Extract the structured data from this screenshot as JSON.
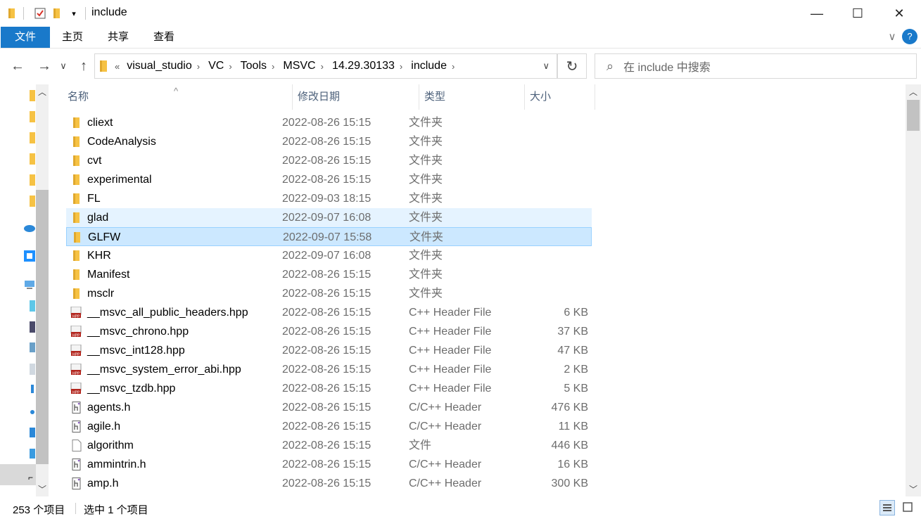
{
  "window": {
    "title": "include",
    "minimize_glyph": "—",
    "maximize_glyph": "☐",
    "close_glyph": "✕"
  },
  "ribbon": {
    "tabs": [
      "文件",
      "主页",
      "共享",
      "查看"
    ],
    "expand_glyph": "∨",
    "help_glyph": "?"
  },
  "address": {
    "overflow_glyph": "«",
    "crumbs": [
      "visual_studio",
      "VC",
      "Tools",
      "MSVC",
      "14.29.30133",
      "include"
    ],
    "sep_glyph": "›",
    "dropdown_glyph": "∨",
    "refresh_glyph": "↻"
  },
  "nav": {
    "back_glyph": "←",
    "forward_glyph": "→",
    "recent_glyph": "∨",
    "up_glyph": "↑"
  },
  "search": {
    "placeholder": "在 include 中搜索",
    "icon_glyph": "⌕"
  },
  "columns": {
    "name": "名称",
    "date": "修改日期",
    "type": "类型",
    "size": "大小",
    "sort_glyph": "^"
  },
  "files": [
    {
      "name": "cliext",
      "date": "2022-08-26 15:15",
      "type": "文件夹",
      "size": "",
      "icon": "folder-icon"
    },
    {
      "name": "CodeAnalysis",
      "date": "2022-08-26 15:15",
      "type": "文件夹",
      "size": "",
      "icon": "folder-icon"
    },
    {
      "name": "cvt",
      "date": "2022-08-26 15:15",
      "type": "文件夹",
      "size": "",
      "icon": "folder-icon"
    },
    {
      "name": "experimental",
      "date": "2022-08-26 15:15",
      "type": "文件夹",
      "size": "",
      "icon": "folder-icon"
    },
    {
      "name": "FL",
      "date": "2022-09-03 18:15",
      "type": "文件夹",
      "size": "",
      "icon": "folder-icon"
    },
    {
      "name": "glad",
      "date": "2022-09-07 16:08",
      "type": "文件夹",
      "size": "",
      "icon": "folder-icon"
    },
    {
      "name": "GLFW",
      "date": "2022-09-07 15:58",
      "type": "文件夹",
      "size": "",
      "icon": "folder-icon"
    },
    {
      "name": "KHR",
      "date": "2022-09-07 16:08",
      "type": "文件夹",
      "size": "",
      "icon": "folder-icon"
    },
    {
      "name": "Manifest",
      "date": "2022-08-26 15:15",
      "type": "文件夹",
      "size": "",
      "icon": "folder-icon"
    },
    {
      "name": "msclr",
      "date": "2022-08-26 15:15",
      "type": "文件夹",
      "size": "",
      "icon": "folder-icon"
    },
    {
      "name": "__msvc_all_public_headers.hpp",
      "date": "2022-08-26 15:15",
      "type": "C++ Header File",
      "size": "6 KB",
      "icon": "hpp-file-icon"
    },
    {
      "name": "__msvc_chrono.hpp",
      "date": "2022-08-26 15:15",
      "type": "C++ Header File",
      "size": "37 KB",
      "icon": "hpp-file-icon"
    },
    {
      "name": "__msvc_int128.hpp",
      "date": "2022-08-26 15:15",
      "type": "C++ Header File",
      "size": "47 KB",
      "icon": "hpp-file-icon"
    },
    {
      "name": "__msvc_system_error_abi.hpp",
      "date": "2022-08-26 15:15",
      "type": "C++ Header File",
      "size": "2 KB",
      "icon": "hpp-file-icon"
    },
    {
      "name": "__msvc_tzdb.hpp",
      "date": "2022-08-26 15:15",
      "type": "C++ Header File",
      "size": "5 KB",
      "icon": "hpp-file-icon"
    },
    {
      "name": "agents.h",
      "date": "2022-08-26 15:15",
      "type": "C/C++ Header",
      "size": "476 KB",
      "icon": "h-file-icon"
    },
    {
      "name": "agile.h",
      "date": "2022-08-26 15:15",
      "type": "C/C++ Header",
      "size": "11 KB",
      "icon": "h-file-icon"
    },
    {
      "name": "algorithm",
      "date": "2022-08-26 15:15",
      "type": "文件",
      "size": "446 KB",
      "icon": "blank-file-icon"
    },
    {
      "name": "ammintrin.h",
      "date": "2022-08-26 15:15",
      "type": "C/C++ Header",
      "size": "16 KB",
      "icon": "h-file-icon"
    },
    {
      "name": "amp.h",
      "date": "2022-08-26 15:15",
      "type": "C/C++ Header",
      "size": "300 KB",
      "icon": "h-file-icon"
    }
  ],
  "hover_index": 5,
  "selected_index": 6,
  "status": {
    "count": "253 个项目",
    "selected": "选中 1 个项目"
  },
  "colors": {
    "accent": "#1979ca",
    "folder": "#f6c244",
    "hover_row": "#e5f3ff",
    "selected_row": "#cce8ff"
  }
}
